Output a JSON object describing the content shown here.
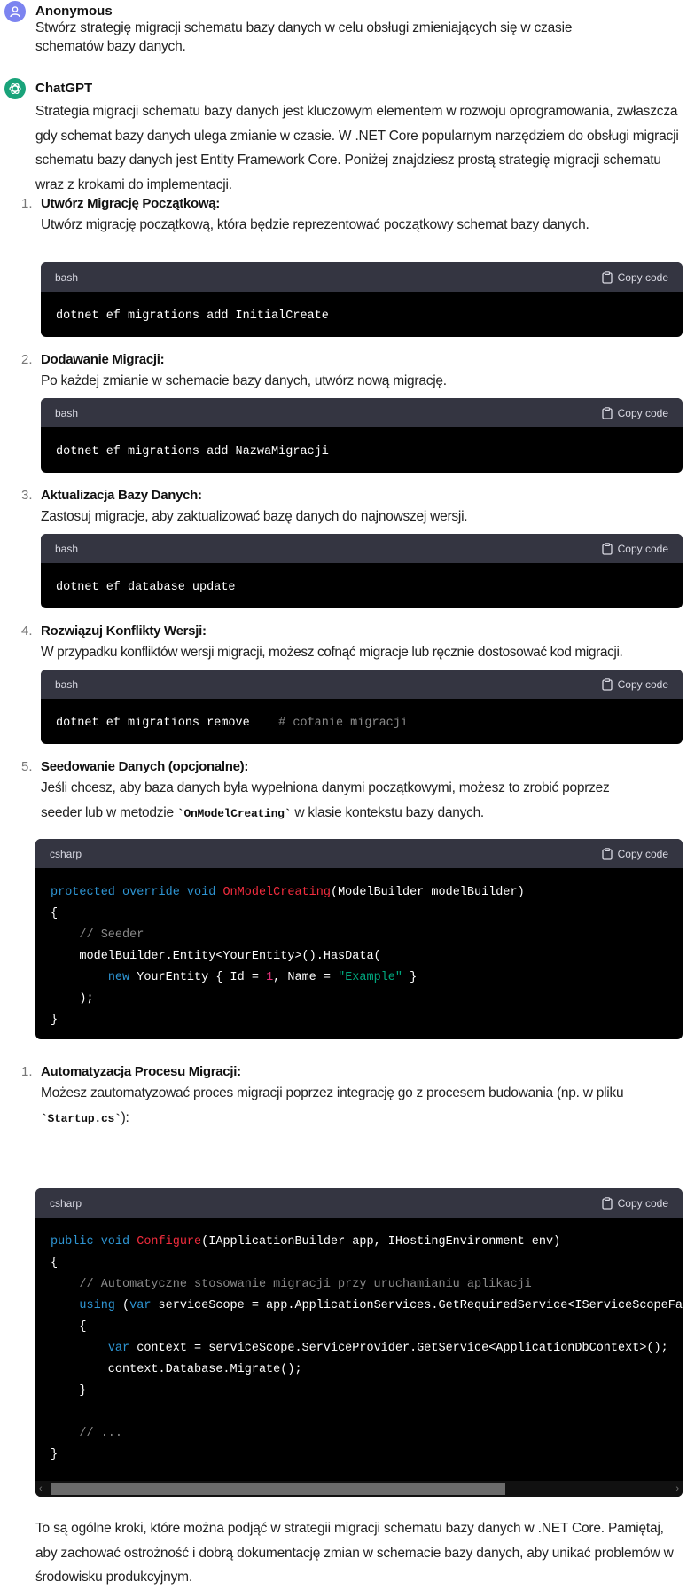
{
  "user_message": {
    "author": "Anonymous",
    "text": "Stwórz strategię migracji schematu bazy danych w celu obsługi zmieniających się w czasie schematów bazy danych.",
    "avatar_icon": "user-icon",
    "avatar_color": "#7c84f0"
  },
  "assistant_message": {
    "author": "ChatGPT",
    "avatar_icon": "openai-logo-icon",
    "avatar_color": "#19a37a",
    "intro": "Strategia migracji schematu bazy danych jest kluczowym elementem w rozwoju oprogramowania, zwłaszcza gdy schemat bazy danych ulega zmianie w czasie. W .NET Core popularnym narzędziem do obsługi migracji schematu bazy danych jest Entity Framework Core. Poniżej znajdziesz prostą strategię migracji schematu wraz z krokami do implementacji.",
    "copy_label": "Copy code",
    "steps": [
      {
        "number": "1.",
        "title": "Utwórz Migrację Początkową:",
        "text": "Utwórz migrację początkową, która będzie reprezentować początkowy schemat bazy danych.",
        "code_lang": "bash",
        "code": "dotnet ef migrations add InitialCreate"
      },
      {
        "number": "2.",
        "title": "Dodawanie Migracji:",
        "text": "Po każdej zmianie w schemacie bazy danych, utwórz nową migrację.",
        "code_lang": "bash",
        "code": "dotnet ef migrations add NazwaMigracji"
      },
      {
        "number": "3.",
        "title": "Aktualizacja Bazy Danych:",
        "text": "Zastosuj migracje, aby zaktualizować bazę danych do najnowszej wersji.",
        "code_lang": "bash",
        "code": "dotnet ef database update"
      },
      {
        "number": "4.",
        "title": "Rozwiązuj Konflikty Wersji:",
        "text": "W przypadku konfliktów wersji migracji, możesz cofnąć migracje lub ręcznie dostosować kod migracji.",
        "code_lang": "bash",
        "code": "dotnet ef migrations remove",
        "code_comment": "# cofanie migracji"
      },
      {
        "number": "5.",
        "title": "Seedowanie Danych (opcjonalne):",
        "text_before": "Jeśli chcesz, aby baza danych była wypełniona danymi początkowymi, możesz to zrobić poprzez seeder lub w metodzie ",
        "inline_code": "`OnModelCreating`",
        "text_after": " w klasie kontekstu bazy danych.",
        "code_lang": "csharp"
      },
      {
        "number": "1.",
        "title": "Automatyzacja Procesu Migracji:",
        "text_before": "Możesz zautomatyzować proces migracji poprzez integrację go z procesem budowania (np. w pliku ",
        "inline_code": "`Startup.cs`",
        "text_after": "):",
        "code_lang": "csharp"
      }
    ],
    "code5": {
      "l1_kw": "protected override void ",
      "l1_fn": "OnModelCreating",
      "l1_rest": "(ModelBuilder modelBuilder)",
      "l2": "{",
      "l3_cm": "    // Seeder",
      "l4": "    modelBuilder.Entity<YourEntity>().HasData(",
      "l5_pre": "        ",
      "l5_kw": "new",
      "l5_a": " YourEntity { Id = ",
      "l5_num": "1",
      "l5_b": ", Name = ",
      "l5_str": "\"Example\"",
      "l5_c": " }",
      "l6": "    );",
      "l7": "}"
    },
    "code6": {
      "l1_kw": "public void ",
      "l1_fn": "Configure",
      "l1_rest": "(IApplicationBuilder app, IHostingEnvironment env)",
      "l2": "{",
      "l3_cm": "    // Automatyczne stosowanie migracji przy uruchamianiu aplikacji",
      "l4_pre": "    ",
      "l4_kw1": "using",
      "l4_a": " (",
      "l4_kw2": "var",
      "l4_b": " serviceScope = app.ApplicationServices.GetRequiredService<IServiceScopeFactory>().CreateScope())",
      "l5": "    {",
      "l6_pre": "        ",
      "l6_kw": "var",
      "l6_a": " context = serviceScope.ServiceProvider.GetService<ApplicationDbContext>();",
      "l7": "        context.Database.Migrate();",
      "l8": "    }",
      "l9": "",
      "l10_cm": "    // ...",
      "l11": "}"
    },
    "outro": "To są ogólne kroki, które można podjąć w strategii migracji schematu bazy danych w .NET Core. Pamiętaj, aby zachować ostrożność i dobrą dokumentację zmian w schemacie bazy danych, aby unikać problemów w środowisku produkcyjnym."
  }
}
